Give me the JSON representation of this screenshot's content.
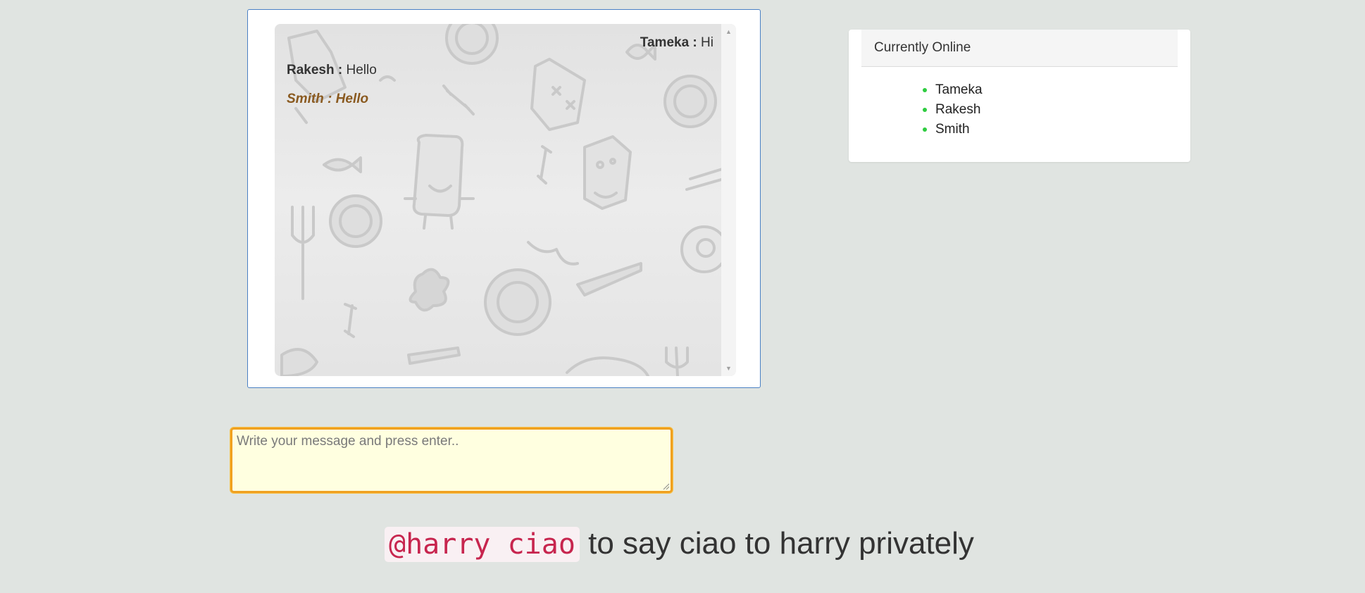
{
  "chat": {
    "messages": [
      {
        "sender": "Tameka",
        "separator": " : ",
        "text": "Hi"
      },
      {
        "sender": "Rakesh",
        "separator": " : ",
        "text": "Hello"
      },
      {
        "full": "Smith : Hello"
      }
    ]
  },
  "online": {
    "title": "Currently Online",
    "users": [
      "Tameka",
      "Rakesh",
      "Smith"
    ],
    "status_color": "#2ecc40"
  },
  "composer": {
    "placeholder": "Write your message and press enter.."
  },
  "hint": {
    "code": "@harry ciao",
    "text": " to say ciao to harry privately"
  },
  "colors": {
    "panel_border": "#4a80c4",
    "input_border": "#f0a020",
    "input_background": "#ffffe0",
    "self_message": "#8a5a20",
    "code_text": "#c7254e"
  }
}
